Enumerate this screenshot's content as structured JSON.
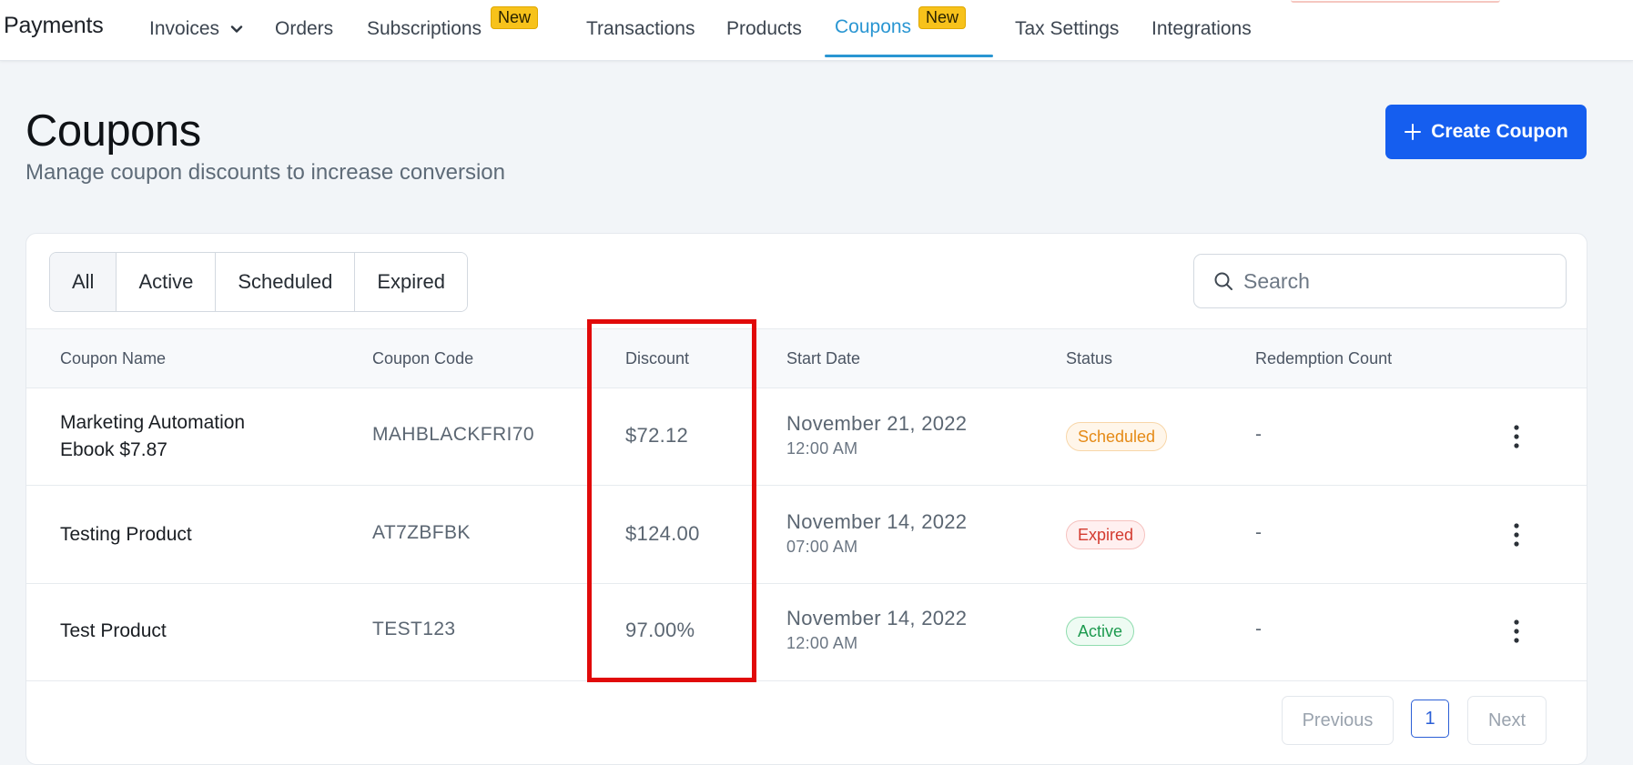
{
  "nav": {
    "app_title": "Payments",
    "items": [
      {
        "label": "Invoices"
      },
      {
        "label": "Orders"
      },
      {
        "label": "Subscriptions"
      },
      {
        "label": "Transactions"
      },
      {
        "label": "Products"
      },
      {
        "label": "Coupons"
      },
      {
        "label": "Tax Settings"
      },
      {
        "label": "Integrations"
      }
    ],
    "new_badge": "New",
    "active_item": "Coupons"
  },
  "header": {
    "title": "Coupons",
    "subtitle": "Manage coupon discounts to increase conversion",
    "create_button": "Create Coupon"
  },
  "filters": {
    "tabs": [
      "All",
      "Active",
      "Scheduled",
      "Expired"
    ],
    "selected": "All"
  },
  "search": {
    "placeholder": "Search"
  },
  "table": {
    "columns": [
      "Coupon Name",
      "Coupon Code",
      "Discount",
      "Start Date",
      "Status",
      "Redemption Count"
    ],
    "rows": [
      {
        "name_line1": "Marketing Automation",
        "name_line2": "Ebook $7.87",
        "code": "MAHBLACKFRI70",
        "discount": "$72.12",
        "start_date": "November 21, 2022",
        "start_time": "12:00 AM",
        "status": "Scheduled",
        "redemption_count": "-"
      },
      {
        "name_line1": "Testing Product",
        "code": "AT7ZBFBK",
        "discount": "$124.00",
        "start_date": "November 14, 2022",
        "start_time": "07:00 AM",
        "status": "Expired",
        "redemption_count": "-"
      },
      {
        "name_line1": "Test Product",
        "code": "TEST123",
        "discount": "97.00%",
        "start_date": "November 14, 2022",
        "start_time": "12:00 AM",
        "status": "Active",
        "redemption_count": "-"
      }
    ]
  },
  "pagination": {
    "previous": "Previous",
    "current_page": "1",
    "next": "Next"
  },
  "colors": {
    "accent": "#155eef",
    "nav_active": "#2a96d2",
    "highlight": "#e10a0a",
    "badge_new": "#f7c21b"
  },
  "icons": {
    "chevron": "chevron-down-icon",
    "plus": "plus-icon",
    "search": "search-icon",
    "more": "more-vertical-icon"
  }
}
